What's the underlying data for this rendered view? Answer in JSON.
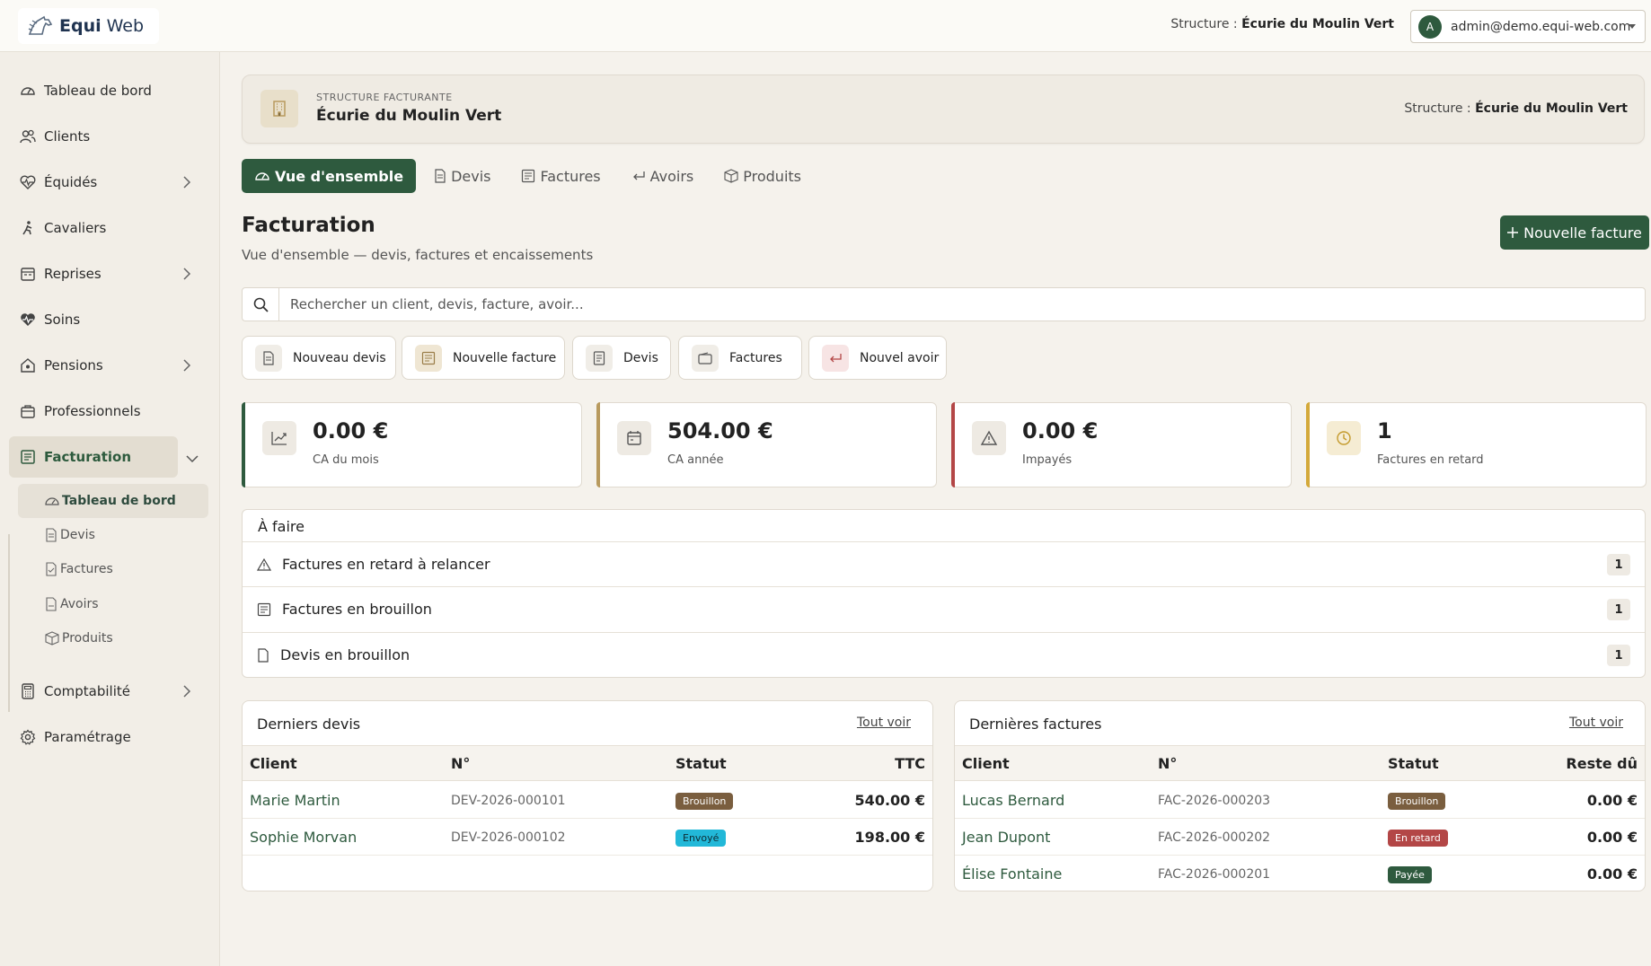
{
  "app": {
    "name_bold": "Equi",
    "name_light": "Web"
  },
  "topbar": {
    "structure_label": "Structure :",
    "structure_name": "Écurie du Moulin Vert",
    "user_initial": "A",
    "user_email": "admin@demo.equi-web.com"
  },
  "sidebar": {
    "items": [
      {
        "label": "Tableau de bord"
      },
      {
        "label": "Clients"
      },
      {
        "label": "Équidés"
      },
      {
        "label": "Cavaliers"
      },
      {
        "label": "Reprises"
      },
      {
        "label": "Soins"
      },
      {
        "label": "Pensions"
      },
      {
        "label": "Professionnels"
      },
      {
        "label": "Facturation"
      },
      {
        "label": "Comptabilité"
      },
      {
        "label": "Paramétrage"
      }
    ],
    "sub_items": [
      {
        "label": "Tableau de bord"
      },
      {
        "label": "Devis"
      },
      {
        "label": "Factures"
      },
      {
        "label": "Avoirs"
      },
      {
        "label": "Produits"
      }
    ]
  },
  "banner": {
    "label": "Structure facturante",
    "name": "Écurie du Moulin Vert",
    "right_label": "Structure :",
    "right_name": "Écurie du Moulin Vert"
  },
  "tabs": [
    {
      "label": "Vue d'ensemble"
    },
    {
      "label": "Devis"
    },
    {
      "label": "Factures"
    },
    {
      "label": "Avoirs"
    },
    {
      "label": "Produits"
    }
  ],
  "page": {
    "title": "Facturation",
    "subtitle": "Vue d'ensemble — devis, factures et encaissements",
    "new_invoice": "Nouvelle facture"
  },
  "search": {
    "placeholder": "Rechercher un client, devis, facture, avoir..."
  },
  "quick_actions": [
    {
      "label": "Nouveau devis"
    },
    {
      "label": "Nouvelle facture"
    },
    {
      "label": "Devis"
    },
    {
      "label": "Factures"
    },
    {
      "label": "Nouvel avoir"
    }
  ],
  "kpis": [
    {
      "value": "0.00 €",
      "label": "CA du mois",
      "color": "#2e5a3e"
    },
    {
      "value": "504.00 €",
      "label": "CA année",
      "color": "#b89a5e"
    },
    {
      "value": "0.00 €",
      "label": "Impayés",
      "color": "#b34646"
    },
    {
      "value": "1",
      "label": "Factures en retard",
      "color": "#d4a93a"
    }
  ],
  "todo": {
    "title": "À faire",
    "rows": [
      {
        "label": "Factures en retard à relancer",
        "count": "1"
      },
      {
        "label": "Factures en brouillon",
        "count": "1"
      },
      {
        "label": "Devis en brouillon",
        "count": "1"
      }
    ]
  },
  "quotes": {
    "title": "Derniers devis",
    "link": "Tout voir",
    "headers": [
      "Client",
      "N°",
      "Statut",
      "TTC"
    ],
    "rows": [
      {
        "client": "Marie Martin",
        "number": "DEV-2026-000101",
        "status": "Brouillon",
        "status_color": "#7a5e3f",
        "amount": "540.00 €"
      },
      {
        "client": "Sophie Morvan",
        "number": "DEV-2026-000102",
        "status": "Envoyé",
        "status_color": "#22b8d8",
        "amount": "198.00 €"
      }
    ]
  },
  "invoices": {
    "title": "Dernières factures",
    "link": "Tout voir",
    "headers": [
      "Client",
      "N°",
      "Statut",
      "Reste dû"
    ],
    "rows": [
      {
        "client": "Lucas Bernard",
        "number": "FAC-2026-000203",
        "status": "Brouillon",
        "status_color": "#7a5e3f",
        "amount": "0.00 €"
      },
      {
        "client": "Jean Dupont",
        "number": "FAC-2026-000202",
        "status": "En retard",
        "status_color": "#b34646",
        "amount": "0.00 €"
      },
      {
        "client": "Élise Fontaine",
        "number": "FAC-2026-000201",
        "status": "Payée",
        "status_color": "#2e5a3e",
        "amount": "0.00 €"
      }
    ]
  }
}
